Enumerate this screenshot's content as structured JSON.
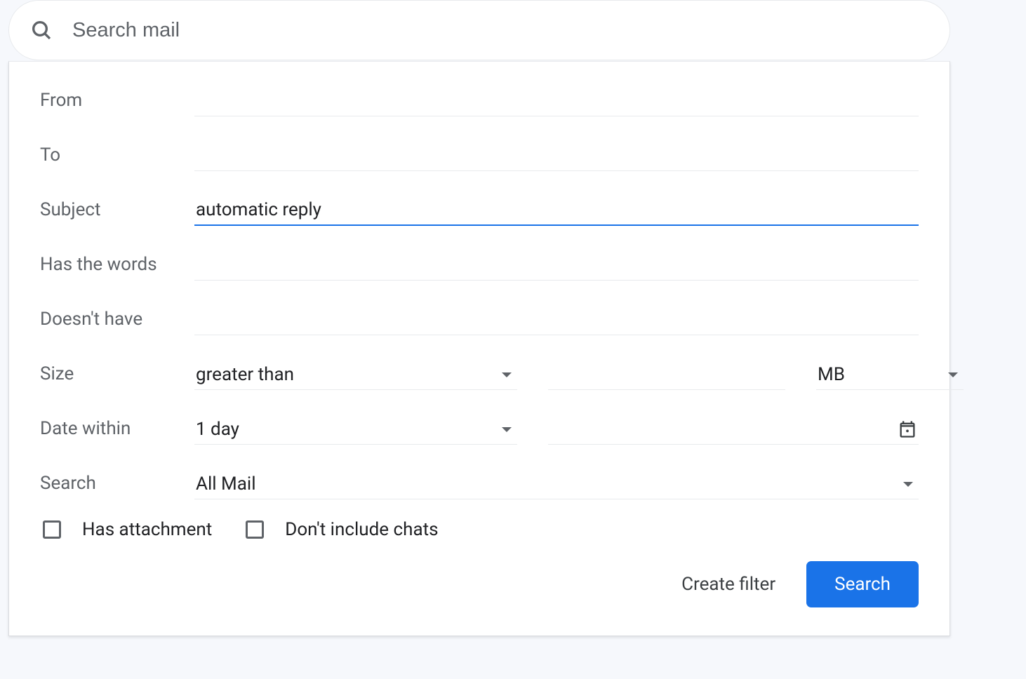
{
  "search": {
    "placeholder": "Search mail",
    "value": ""
  },
  "fields": {
    "from": {
      "label": "From",
      "value": ""
    },
    "to": {
      "label": "To",
      "value": ""
    },
    "subject": {
      "label": "Subject",
      "value": "automatic reply"
    },
    "has_words": {
      "label": "Has the words",
      "value": ""
    },
    "doesnt_have": {
      "label": "Doesn't have",
      "value": ""
    },
    "size": {
      "label": "Size",
      "comparison": "greater than",
      "amount": "",
      "unit": "MB"
    },
    "date_within": {
      "label": "Date within",
      "range": "1 day",
      "date": ""
    },
    "search_in": {
      "label": "Search",
      "value": "All Mail"
    }
  },
  "checkboxes": {
    "has_attachment": {
      "label": "Has attachment",
      "checked": false
    },
    "exclude_chats": {
      "label": "Don't include chats",
      "checked": false
    }
  },
  "actions": {
    "create_filter": "Create filter",
    "search": "Search"
  }
}
